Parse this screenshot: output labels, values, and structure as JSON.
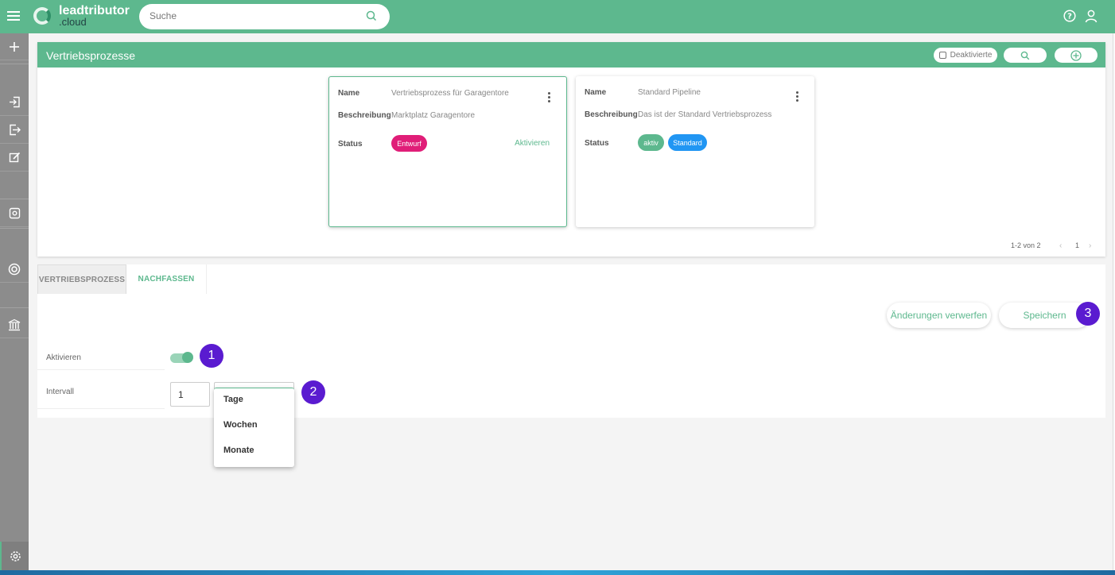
{
  "app": {
    "brand": "leadtributor",
    "brand_sub": ".cloud",
    "search_placeholder": "Suche"
  },
  "panel": {
    "title": "Vertriebsprozesse",
    "deaktivierte_label": "Deaktivierte",
    "cards": [
      {
        "name_label": "Name",
        "name": "Vertriebsprozess für Garagentore",
        "desc_label": "Beschreibung",
        "desc": "Marktplatz Garagentore",
        "status_label": "Status",
        "status": "Entwurf",
        "status_color": "#e01e78",
        "action": "Aktivieren"
      },
      {
        "name_label": "Name",
        "name": "Standard Pipeline",
        "desc_label": "Beschreibung",
        "desc": "Das ist der Standard Vertriebsprozess",
        "status_label": "Status",
        "status": "aktiv",
        "status_color": "#5db88e",
        "extra_badge": "Standard",
        "extra_badge_color": "#2196f3"
      }
    ],
    "pagination": {
      "range": "1-2 von 2",
      "page": "1"
    }
  },
  "tabs": [
    {
      "label": "VERTRIEBSPROZESS",
      "active": true
    },
    {
      "label": "NACHFASSEN",
      "active": false
    }
  ],
  "actions": {
    "discard": "Änderungen verwerfen",
    "save": "Speichern"
  },
  "form": {
    "activate_label": "Aktivieren",
    "activate_on": true,
    "interval_label": "Intervall",
    "interval_value": "1",
    "unit_options": [
      "Tage",
      "Wochen",
      "Monate"
    ]
  },
  "annotations": [
    "1",
    "2",
    "3"
  ],
  "colors": {
    "primary": "#5db88e",
    "annotation": "#5a1bd0",
    "sidebar": "#8c8c8c"
  }
}
